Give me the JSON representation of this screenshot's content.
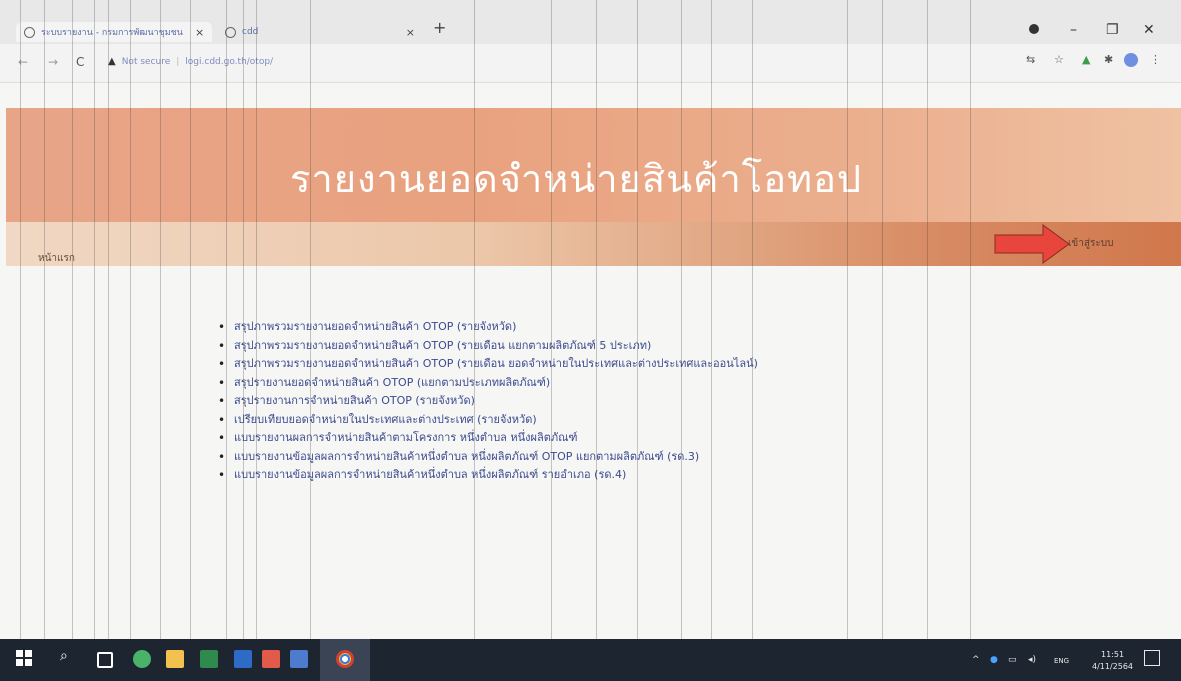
{
  "browser": {
    "tabs": [
      {
        "title": "ระบบรายงาน - กรมการพัฒนาชุมชน",
        "active": true
      },
      {
        "title": "cdd",
        "active": false
      }
    ],
    "new_tab_label": "+",
    "nav": {
      "back": "←",
      "forward": "→",
      "reload": "C"
    },
    "address": {
      "security_label": "Not secure",
      "url": "logi.cdd.go.th/otop/"
    },
    "window_controls": {
      "minimize": "–",
      "maximize": "❐",
      "close": "✕"
    }
  },
  "page": {
    "title": "รายงานยอดจำหน่ายสินค้าโอทอป",
    "menu": {
      "home": "หน้าแรก",
      "admin": "เข้าสู่ระบบ"
    },
    "reports": [
      "สรุปภาพรวมรายงานยอดจำหน่ายสินค้า OTOP (รายจังหวัด)",
      "สรุปภาพรวมรายงานยอดจำหน่ายสินค้า OTOP (รายเดือน แยกตามผลิตภัณฑ์ 5 ประเภท)",
      "สรุปภาพรวมรายงานยอดจำหน่ายสินค้า OTOP (รายเดือน ยอดจำหน่ายในประเทศและต่างประเทศและออนไลน์)",
      "สรุปรายงานยอดจำหน่ายสินค้า OTOP (แยกตามประเภทผลิตภัณฑ์)",
      "สรุปรายงานการจำหน่ายสินค้า OTOP (รายจังหวัด)",
      "เปรียบเทียบยอดจำหน่ายในประเทศและต่างประเทศ (รายจังหวัด)",
      "แบบรายงานผลการจำหน่ายสินค้าตามโครงการ หนึ่งตำบล หนึ่งผลิตภัณฑ์",
      "แบบรายงานข้อมูลผลการจำหน่ายสินค้าหนึ่งตำบล หนึ่งผลิตภัณฑ์ OTOP แยกตามผลิตภัณฑ์ (รด.3)",
      "แบบรายงานข้อมูลผลการจำหน่ายสินค้าหนึ่งตำบล หนึ่งผลิตภัณฑ์ รายอำเภอ (รด.4)"
    ]
  },
  "taskbar": {
    "tray": {
      "lang": "ENG"
    },
    "clock": {
      "time": "11:51",
      "date": "4/11/2564"
    }
  },
  "colors": {
    "banner": "#e9a27f",
    "arrow": "#e8463c",
    "link": "#3b4a8f"
  }
}
